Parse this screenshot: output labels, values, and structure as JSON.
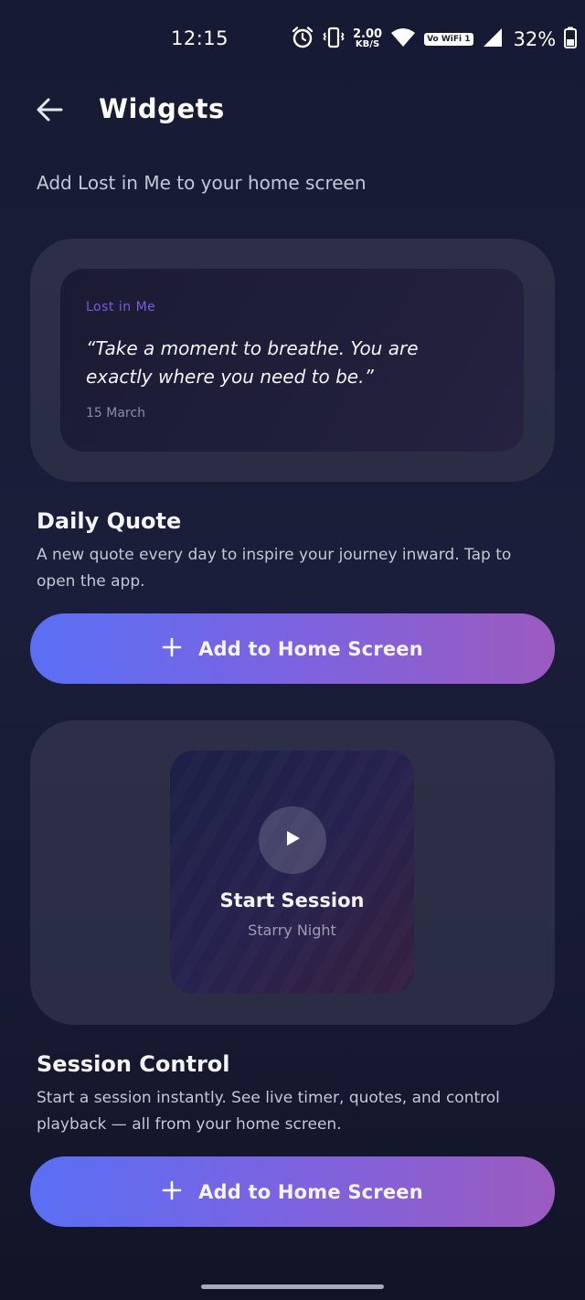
{
  "status_bar": {
    "time": "12:15",
    "net_speed_value": "2.00",
    "net_speed_unit": "KB/S",
    "volte_label": "Vo WiFi 1",
    "battery_percent": "32%",
    "icons": [
      "alarm-icon",
      "vibrate-icon",
      "wifi-icon",
      "signal-icon",
      "battery-icon"
    ]
  },
  "header": {
    "title": "Widgets",
    "back_icon": "arrow-left-icon"
  },
  "subtitle": "Add Lost in Me to your home screen",
  "daily_quote": {
    "preview": {
      "app_name": "Lost in Me",
      "quote": "“Take a moment to breathe. You are exactly where you need to be.”",
      "date": "15 March"
    },
    "title": "Daily Quote",
    "description": "A new quote every day to inspire your journey inward. Tap to open the app.",
    "button_label": "Add to Home Screen"
  },
  "session_control": {
    "preview": {
      "title": "Start Session",
      "subtitle": "Starry Night"
    },
    "title": "Session Control",
    "description": "Start a session instantly. See live timer, quotes, and control playback — all from your home screen.",
    "button_label": "Add to Home Screen"
  },
  "colors": {
    "background": "#171a33",
    "card": "#2c2f47",
    "accent_purple": "#7c5be0",
    "button_gradient_start": "#5a6ff5",
    "button_gradient_end": "#9b5bbf"
  }
}
